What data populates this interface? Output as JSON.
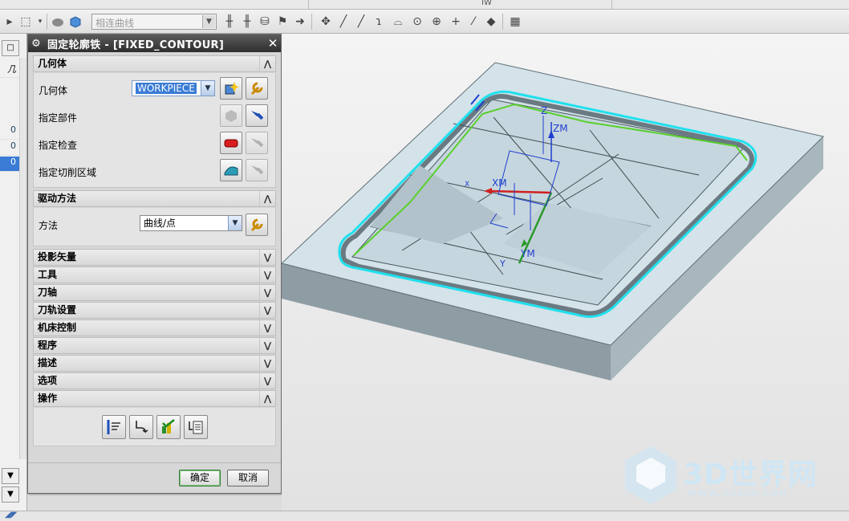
{
  "toolbar": {
    "curve_filter": {
      "value": "相连曲线",
      "placeholder": "相连曲线"
    },
    "top_segment_text": "IW"
  },
  "left_panel": {
    "header_col": "几",
    "rows": [
      "0",
      "0",
      "0"
    ]
  },
  "dialog": {
    "title": "固定轮廓铁 - [FIXED_CONTOUR]",
    "groups": {
      "geometry": {
        "title": "几何体",
        "geometry_label": "几何体",
        "geometry_value": "WORKPIECE",
        "part_label": "指定部件",
        "check_label": "指定检查",
        "cut_area_label": "指定切削区域"
      },
      "drive": {
        "title": "驱动方法",
        "method_label": "方法",
        "method_value": "曲线/点"
      }
    },
    "collapsed": [
      {
        "id": "proj",
        "title": "投影矢量"
      },
      {
        "id": "tool",
        "title": "工具"
      },
      {
        "id": "axis",
        "title": "刀轴"
      },
      {
        "id": "path",
        "title": "刀轨设置"
      },
      {
        "id": "machine",
        "title": "机床控制"
      },
      {
        "id": "program",
        "title": "程序"
      },
      {
        "id": "desc",
        "title": "描述"
      },
      {
        "id": "options",
        "title": "选项"
      }
    ],
    "actions_title": "操作",
    "ok_label": "确定",
    "cancel_label": "取消"
  },
  "viewport": {
    "axis_labels": {
      "z": "Z",
      "zm": "ZM",
      "xm": "XM",
      "ym": "YM",
      "x": "X",
      "y": "Y"
    }
  },
  "watermark": {
    "brand": "3D世界网",
    "url": "WWW.3DSJW.COM"
  },
  "colors": {
    "title_bar": "#3a3a3a",
    "selection": "#3a7bd5",
    "part_face": "#d6e3ea",
    "toolpath": "#22e0ee",
    "curve": "#5fd33a"
  }
}
